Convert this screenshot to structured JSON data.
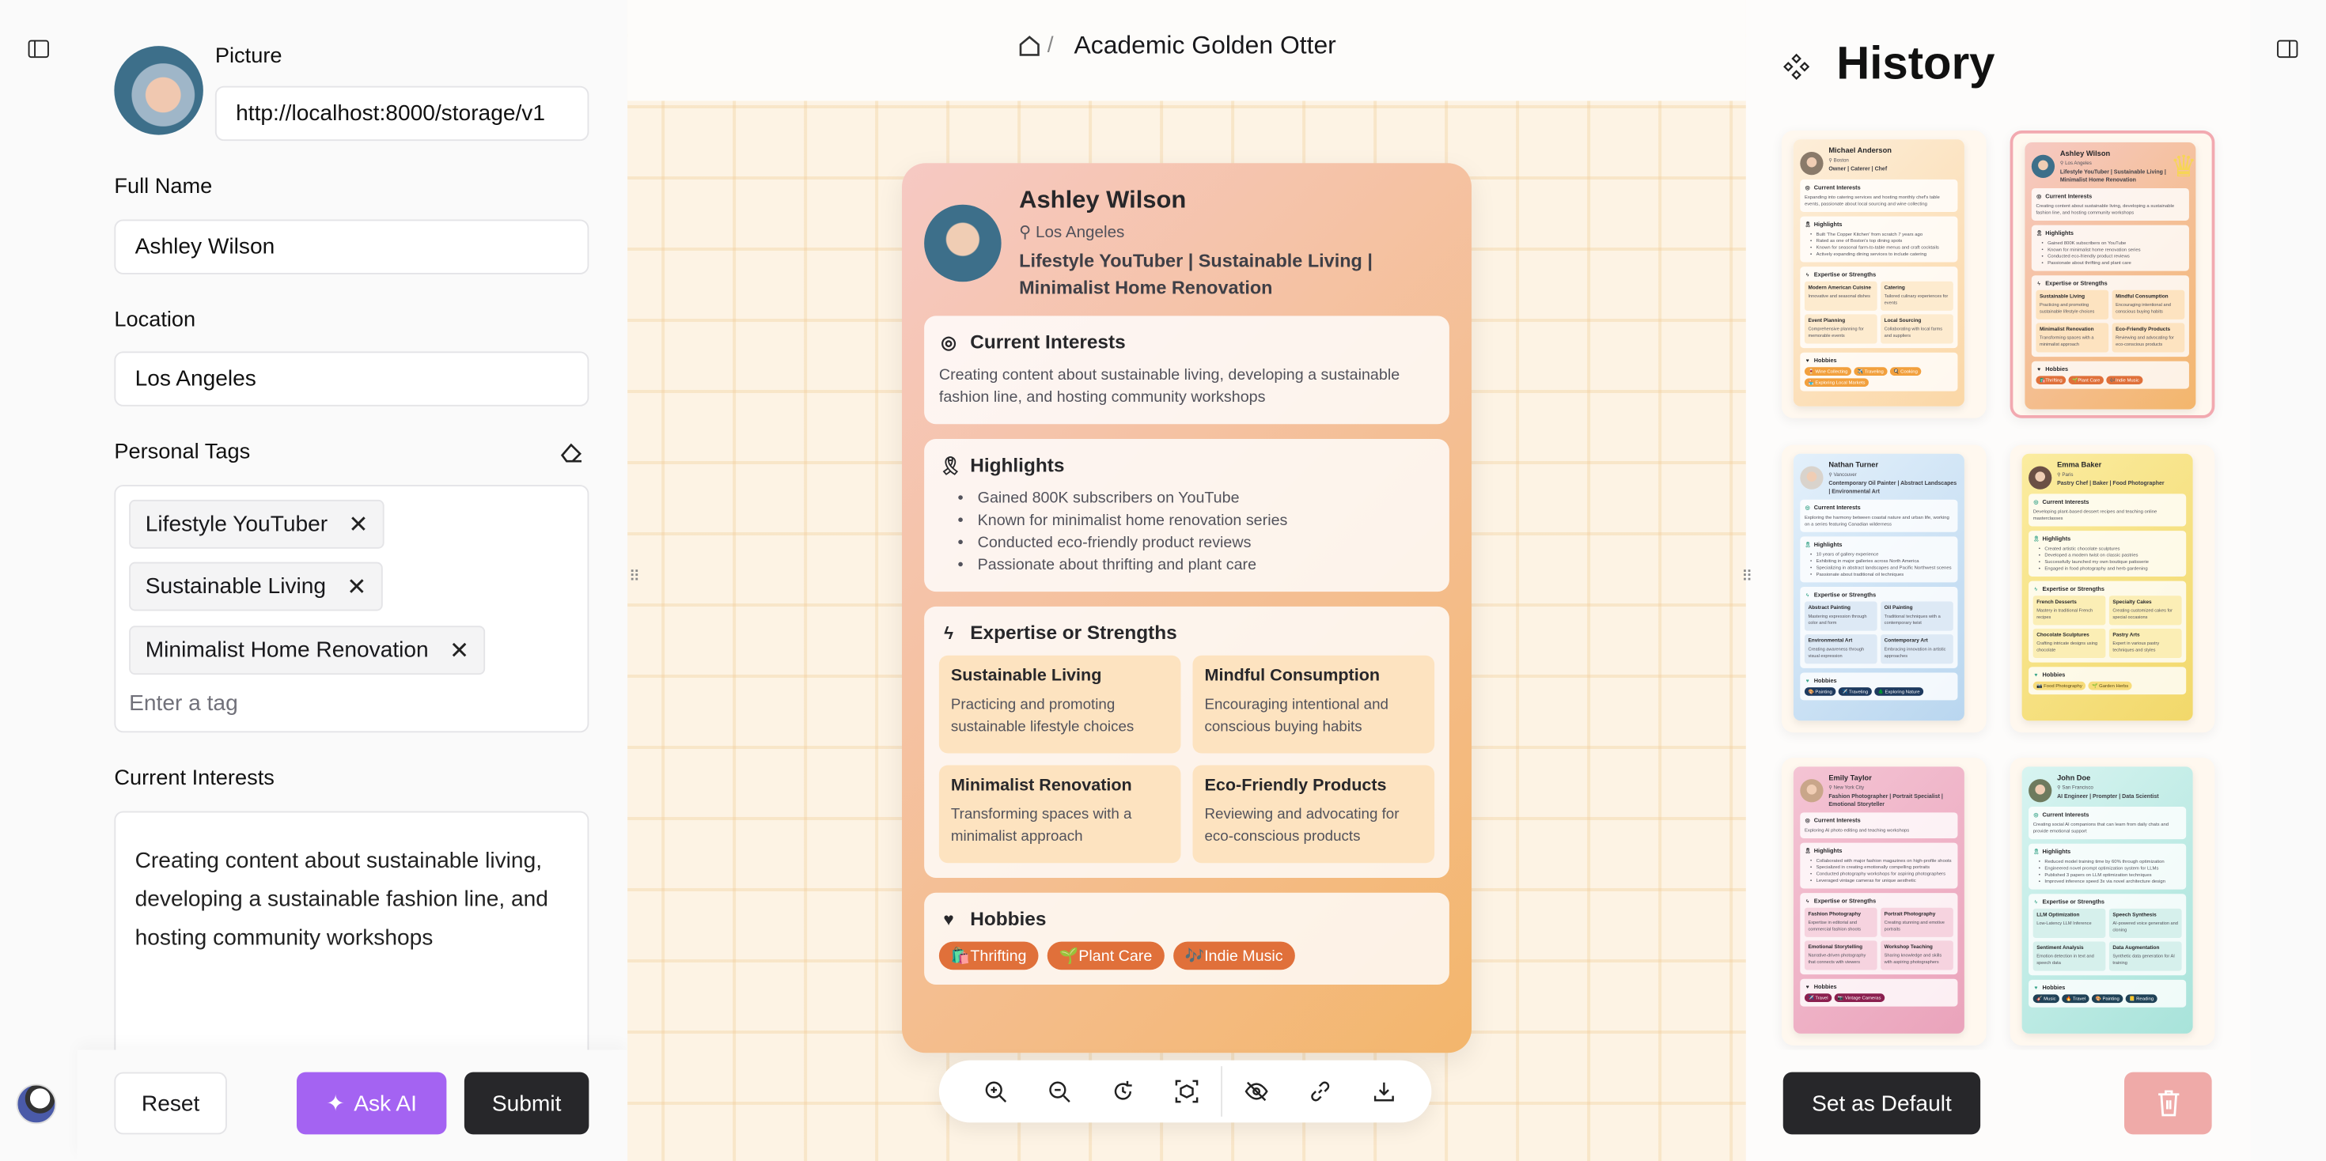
{
  "left_strip": {
    "panel_icon": "sidebar-toggle-icon",
    "user_avatar": "user-avatar"
  },
  "form": {
    "picture_label": "Picture",
    "picture_value": "http://localhost:8000/storage/v1",
    "full_name_label": "Full Name",
    "full_name_value": "Ashley Wilson",
    "location_label": "Location",
    "location_value": "Los Angeles",
    "tags_label": "Personal Tags",
    "tags": [
      "Lifestyle YouTuber",
      "Sustainable Living",
      "Minimalist Home Renovation"
    ],
    "tag_placeholder": "Enter a tag",
    "interests_label": "Current Interests",
    "interests_value": "Creating content about sustainable living, developing a sustainable fashion line, and hosting community workshops",
    "reset_label": "Reset",
    "ask_ai_label": "Ask AI",
    "submit_label": "Submit"
  },
  "header": {
    "breadcrumb_sep": "/",
    "title": "Academic Golden Otter"
  },
  "history": {
    "title": "History",
    "set_default_label": "Set as Default",
    "selected_index": 1
  },
  "colors": {
    "ask_ai": "#a463f2",
    "dark_button": "#27272a",
    "delete_button": "#efaaa8",
    "selected_border": "#f2a9b0",
    "crown": "#f8d94a"
  },
  "profiles": [
    {
      "name": "Michael Anderson",
      "location": "Boston",
      "titles": "Owner | Caterer | Chef",
      "interests": "Expanding into catering services and hosting monthly chef's table events, passionate about local sourcing and wine collecting",
      "highlights": [
        "Built 'The Copper Kitchen' from scratch 7 years ago",
        "Rated as one of Boston's top dining spots",
        "Known for seasonal farm-to-table menus and craft cocktails",
        "Actively expanding dining services to include catering"
      ],
      "expertise": [
        {
          "title": "Modern American Cuisine",
          "desc": "Innovative and seasonal dishes"
        },
        {
          "title": "Catering",
          "desc": "Tailored culinary experiences for events"
        },
        {
          "title": "Event Planning",
          "desc": "Comprehensive planning for memorable events"
        },
        {
          "title": "Local Sourcing",
          "desc": "Collaborating with local farms and suppliers"
        }
      ],
      "hobbies": [
        "🍷 Wine Collecting",
        "✈️ Traveling",
        "🍳 Cooking",
        "🏪 Exploring Local Markets"
      ],
      "theme": {
        "from": "#fdeed9",
        "to": "#fbd7a6",
        "chip": "#f2a03d",
        "chip_text": "#fff",
        "item": "#fdebcf",
        "icon": "#27272a",
        "avatar": "#8a7a6a"
      }
    },
    {
      "name": "Ashley Wilson",
      "location": "Los Angeles",
      "titles": "Lifestyle YouTuber | Sustainable Living | Minimalist Home Renovation",
      "interests": "Creating content about sustainable living, developing a sustainable fashion line, and hosting community workshops",
      "highlights": [
        "Gained 800K subscribers on YouTube",
        "Known for minimalist home renovation series",
        "Conducted eco-friendly product reviews",
        "Passionate about thrifting and plant care"
      ],
      "expertise": [
        {
          "title": "Sustainable Living",
          "desc": "Practicing and promoting sustainable lifestyle choices"
        },
        {
          "title": "Mindful Consumption",
          "desc": "Encouraging intentional and conscious buying habits"
        },
        {
          "title": "Minimalist Renovation",
          "desc": "Transforming spaces with a minimalist approach"
        },
        {
          "title": "Eco-Friendly Products",
          "desc": "Reviewing and advocating for eco-conscious products"
        }
      ],
      "hobbies": [
        "🛍️Thrifting",
        "🌱Plant Care",
        "🎶Indie Music"
      ],
      "theme": {
        "from": "#f6c9c3",
        "to": "#f3b66c",
        "chip": "#e0703a",
        "chip_text": "#fff",
        "item": "#fde3c0",
        "icon": "#27272a",
        "avatar": "#3d6f8a"
      }
    },
    {
      "name": "Nathan Turner",
      "location": "Vancouver",
      "titles": "Contemporary Oil Painter | Abstract Landscapes | Environmental Art",
      "interests": "Exploring the harmony between coastal nature and urban life, working on a series featuring Canadian wilderness",
      "highlights": [
        "10 years of gallery experience",
        "Exhibiting in major galleries across North America",
        "Specializing in abstract landscapes and Pacific Northwest scenes",
        "Passionate about traditional oil techniques"
      ],
      "expertise": [
        {
          "title": "Abstract Painting",
          "desc": "Mastering expression through color and form"
        },
        {
          "title": "Oil Painting",
          "desc": "Traditional techniques with a contemporary twist"
        },
        {
          "title": "Environmental Art",
          "desc": "Creating awareness through visual expression"
        },
        {
          "title": "Contemporary Art",
          "desc": "Embracing innovation in artistic approaches"
        }
      ],
      "hobbies": [
        "🎨 Painting",
        "✈️ Traveling",
        "🌲 Exploring Nature"
      ],
      "theme": {
        "from": "#e3f0fb",
        "to": "#b9d6ef",
        "chip": "#1e3a5f",
        "chip_text": "#fff",
        "item": "#dde9f5",
        "icon": "#3aa58a",
        "avatar": "#d9d3cc"
      }
    },
    {
      "name": "Emma Baker",
      "location": "Paris",
      "titles": "Pastry Chef | Baker | Food Photographer",
      "interests": "Developing plant-based dessert recipes and teaching online masterclasses",
      "highlights": [
        "Created artistic chocolate sculptures",
        "Developed a modern twist on classic pastries",
        "Successfully launched my own boutique patisserie",
        "Engaged in food photography and herb gardening"
      ],
      "expertise": [
        {
          "title": "French Desserts",
          "desc": "Mastery in traditional French recipes"
        },
        {
          "title": "Specialty Cakes",
          "desc": "Creating customized cakes for special occasions"
        },
        {
          "title": "Chocolate Sculptures",
          "desc": "Crafting intricate designs using chocolate"
        },
        {
          "title": "Pastry Arts",
          "desc": "Expert in various pastry techniques and styles"
        }
      ],
      "hobbies": [
        "📷 Food Photography",
        "🌱 Garden Herbs"
      ],
      "theme": {
        "from": "#fbeca0",
        "to": "#f2d86a",
        "chip": "#f7dc7a",
        "chip_text": "#5a4a1a",
        "item": "#fbeeb5",
        "icon": "#3aa58a",
        "avatar": "#6b4f45"
      }
    },
    {
      "name": "Emily Taylor",
      "location": "New York City",
      "titles": "Fashion Photographer | Portrait Specialist | Emotional Storyteller",
      "interests": "Exploring AI photo editing and teaching workshops",
      "highlights": [
        "Collaborated with major fashion magazines on high-profile shoots",
        "Specialized in creating emotionally compelling portraits",
        "Conducted photography workshops for aspiring photographers",
        "Leveraged vintage cameras for unique aesthetic"
      ],
      "expertise": [
        {
          "title": "Fashion Photography",
          "desc": "Expertise in editorial and commercial fashion shoots"
        },
        {
          "title": "Portrait Photography",
          "desc": "Creating stunning and emotive portraits"
        },
        {
          "title": "Emotional Storytelling",
          "desc": "Narrative-driven photography that connects with viewers"
        },
        {
          "title": "Workshop Teaching",
          "desc": "Sharing knowledge and skills with aspiring photographers"
        }
      ],
      "hobbies": [
        "✈️ Travel",
        "📷 Vintage Cameras"
      ],
      "theme": {
        "from": "#f4c4d4",
        "to": "#eaa3bb",
        "chip": "#8b1f4f",
        "chip_text": "#fff",
        "item": "#f6d3df",
        "icon": "#27272a",
        "avatar": "#c9a68a"
      }
    },
    {
      "name": "John Doe",
      "location": "San Francisco",
      "titles": "AI Engineer | Prompter | Data Scientist",
      "interests": "Creating social AI companions that can learn from daily chats and provide emotional support",
      "highlights": [
        "Reduced model training time by 60% through optimization",
        "Engineered novel prompt optimization system for LLMs",
        "Published 3 papers on LLM optimization techniques",
        "Improved inference speed 3x via novel architecture design"
      ],
      "expertise": [
        {
          "title": "LLM Optimization",
          "desc": "Low-Latency LLM Inference"
        },
        {
          "title": "Speech Synthesis",
          "desc": "AI-powered voice generation and cloning"
        },
        {
          "title": "Sentiment Analysis",
          "desc": "Emotion detection in text and speech data"
        },
        {
          "title": "Data Augmentation",
          "desc": "Synthetic data generation for AI training"
        }
      ],
      "hobbies": [
        "🎸 Music",
        "🔥 Travel",
        "🎨 Painting",
        "📒 Reading"
      ],
      "theme": {
        "from": "#d8f4f1",
        "to": "#a8e3da",
        "chip": "#1f4257",
        "chip_text": "#fff",
        "item": "#d6f0ec",
        "icon": "#3aa58a",
        "avatar": "#6e7a5e"
      }
    }
  ],
  "card_sections": {
    "interests": "Current Interests",
    "highlights": "Highlights",
    "expertise": "Expertise or Strengths",
    "hobbies": "Hobbies"
  },
  "toolbar": [
    "zoom-in-icon",
    "zoom-out-icon",
    "rotate-icon",
    "fit-view-icon",
    "hide-icon",
    "link-icon",
    "download-icon"
  ]
}
